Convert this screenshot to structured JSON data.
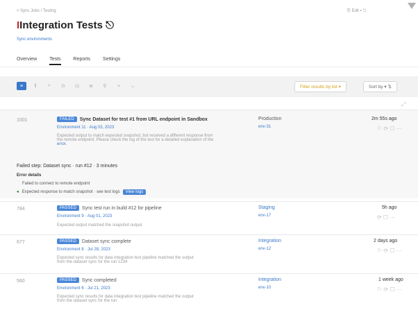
{
  "header": {
    "breadcrumb": "< Sync Jobs / Testing",
    "title_prefix": "I",
    "title": "Integration Tests ⎋",
    "subtitle": "Sync environments",
    "top_right": "⎘ Edit ▾  ⎋",
    "corner_icon": "filter-corner-icon"
  },
  "tabs": [
    {
      "label": "Overview"
    },
    {
      "label": "Tests"
    },
    {
      "label": "Reports"
    },
    {
      "label": "Settings"
    }
  ],
  "toolbar": {
    "buttons": [
      "≡",
      "‖",
      "⌕",
      "⊙",
      "◷",
      "≣",
      "⚲",
      "+",
      "⌄"
    ],
    "filter_label": "Filter results by list ▾",
    "sort_label": "Sort by ▾  ⇅",
    "expand_icon_text": "⤢"
  },
  "rows": [
    {
      "id": "1001",
      "badge": "FAILED",
      "title": "Sync Dataset for test #1 from URL endpoint in Sandbox",
      "meta": "Environment 11 · Aug 03, 2023",
      "desc1": "Expected output to match expected snapshot, but received a different response from",
      "desc2": "the remote endpoint. Please check the log of the test for a detailed explanation of the",
      "desc3": "error.",
      "col_a": "Production",
      "col_b": "env-31",
      "time": "2m 55s ago",
      "actions": "⚐ ⟳ ☐ ⋯"
    },
    {
      "id": "784",
      "badge": "PASSED",
      "title": "Sync test run in build #12 for pipeline",
      "meta": "Environment 9 · Aug 01, 2023",
      "desc1": "Expected output matched the snapshot output",
      "desc2": "",
      "desc3": "",
      "col_a": "Staging",
      "col_b": "env-17",
      "time": "5h ago",
      "actions": "⟳ ☐ ⋯"
    },
    {
      "id": "677",
      "badge": "PASSED",
      "title": "Dataset sync complete",
      "meta": "Environment 8 · Jul 28, 2023",
      "desc1": "Expected sync results for data integration test pipeline matched the output",
      "desc2": "from the dataset sync for the run 1234",
      "desc3": "",
      "col_a": "Integration",
      "col_b": "env-12",
      "time": "2 days ago",
      "actions": "⚐ ⟳ ☐ ⋯"
    },
    {
      "id": "560",
      "badge": "PASSED",
      "title": "Sync completed",
      "meta": "Environment 6 · Jul 21, 2023",
      "desc1": "Expected sync results for data integration test pipeline matched the output",
      "desc2": "from the dataset sync for the run",
      "desc3": "",
      "col_a": "Integration",
      "col_b": "env-10",
      "time": "1 week ago",
      "actions": "⚐ ⟳ ☐ ⋯"
    }
  ],
  "expanded": {
    "line1": "Failed step: Dataset sync · run #12 · 3 minutes",
    "line2": "Error details",
    "line3": "Failed to connect to remote endpoint",
    "line4": "Expected response to match snapshot · see test logs",
    "link": "View logs"
  }
}
